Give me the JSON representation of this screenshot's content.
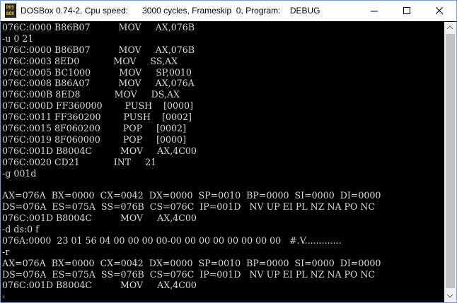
{
  "window": {
    "title": "DOSBox 0.74-2, Cpu speed:      3000 cycles, Frameskip  0, Program:    DEBUG",
    "icon_text_top": "DOS",
    "icon_text_bottom": "BOX"
  },
  "console": {
    "lines": [
      "076C:0000 B86B07          MOV     AX,076B",
      "-u 0 21",
      "076C:0000 B86B07          MOV     AX,076B",
      "076C:0003 8ED0            MOV     SS,AX",
      "076C:0005 BC1000          MOV     SP,0010",
      "076C:0008 B86A07          MOV     AX,076A",
      "076C:000B 8ED8            MOV     DS,AX",
      "076C:000D FF360000        PUSH    [0000]",
      "076C:0011 FF360200        PUSH    [0002]",
      "076C:0015 8F060200        POP     [0002]",
      "076C:0019 8F060000        POP     [0000]",
      "076C:001D B8004C          MOV     AX,4C00",
      "076C:0020 CD21            INT     21",
      "-g 001d",
      "",
      "AX=076A  BX=0000  CX=0042  DX=0000  SP=0010  BP=0000  SI=0000  DI=0000",
      "DS=076A  ES=075A  SS=076B  CS=076C  IP=001D   NV UP EI PL NZ NA PO NC",
      "076C:001D B8004C          MOV     AX,4C00",
      "-d ds:0 f",
      "076A:0000  23 01 56 04 00 00 00 00-00 00 00 00 00 00 00 00   #.V.............",
      "-r",
      "AX=076A  BX=0000  CX=0042  DX=0000  SP=0010  BP=0000  SI=0000  DI=0000",
      "DS=076A  ES=075A  SS=076B  CS=076C  IP=001D   NV UP EI PL NZ NA PO NC",
      "076C:001D B8004C          MOV     AX,4C00",
      "-",
      "→"
    ]
  },
  "colors": {
    "console_bg": "#000000",
    "console_fg": "#d8d8d8",
    "titlebar_bg": "#ffffff",
    "scrollbar_bg": "#f0f0f0"
  },
  "icons": [
    "minimize-icon",
    "maximize-icon",
    "close-icon",
    "scroll-up-icon",
    "scroll-down-icon"
  ]
}
